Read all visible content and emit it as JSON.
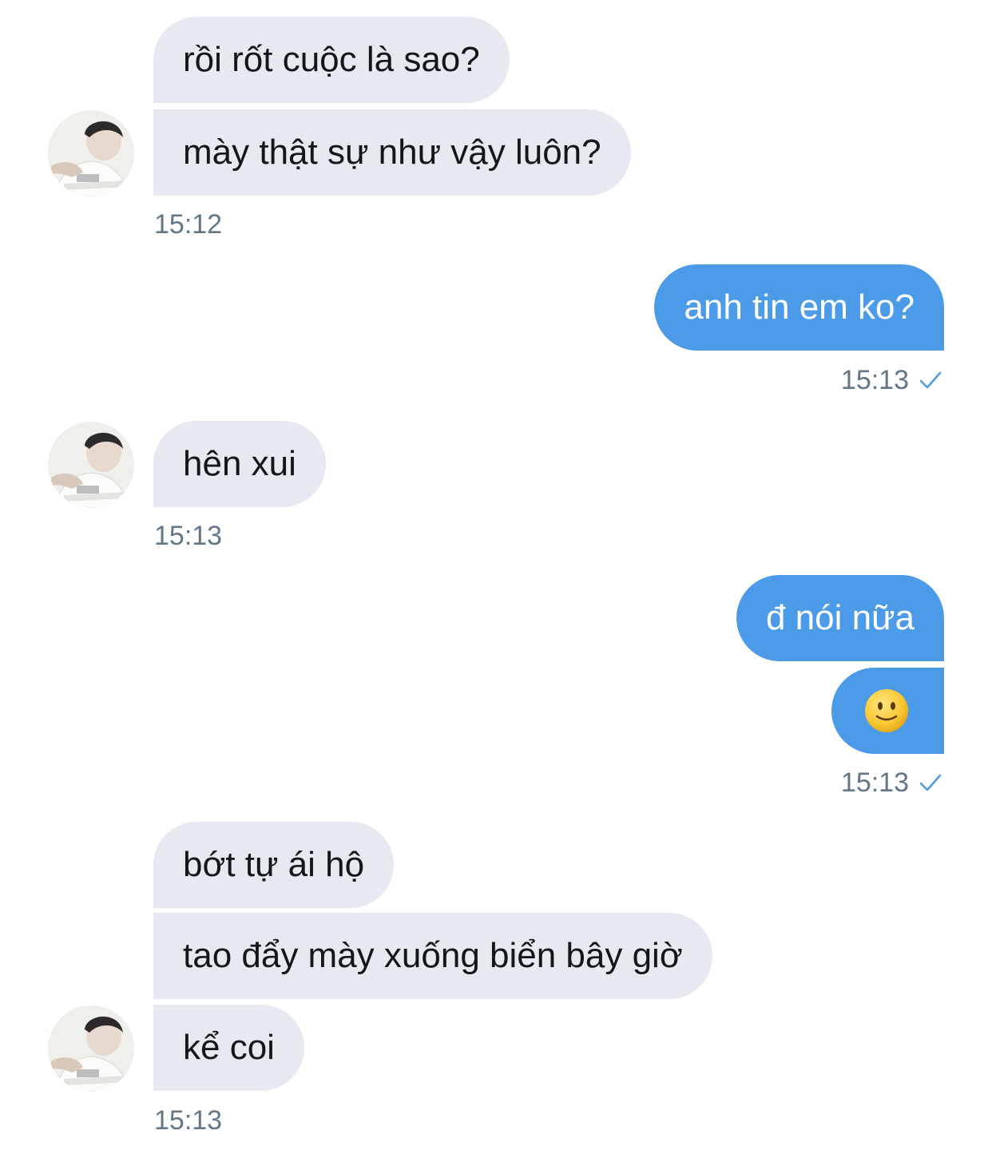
{
  "messages": [
    {
      "text": "rồi rốt cuộc là sao?"
    },
    {
      "text": "mày thật sự như vậy luôn?"
    },
    {
      "text": "anh tin em ko?"
    },
    {
      "text": "hên xui"
    },
    {
      "text": "đ nói nữa"
    },
    {
      "text": "",
      "emoji": "slightly-smiling-face-icon"
    },
    {
      "text": "bớt tự ái hộ"
    },
    {
      "text": "tao đẩy mày xuống biển bây giờ"
    },
    {
      "text": "kể coi"
    }
  ],
  "timestamps": [
    "15:12",
    "15:13",
    "15:13",
    "15:13",
    "15:13"
  ],
  "colors": {
    "received_bubble": "#e6e9ef",
    "sent_bubble": "#4c9be8",
    "timestamp": "#657786",
    "read_check": "#4c9be8"
  },
  "icons": {
    "avatar": "avatar",
    "read_receipt": "checkmark-icon"
  }
}
